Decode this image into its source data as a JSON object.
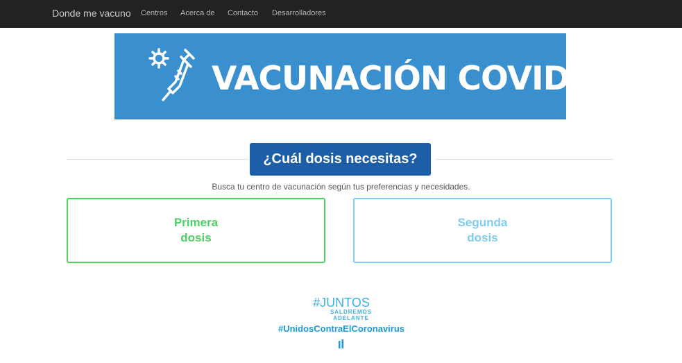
{
  "navbar": {
    "brand": "Donde me vacuno",
    "links": [
      "Centros",
      "Acerca de",
      "Contacto",
      "Desarrolladores"
    ]
  },
  "banner": {
    "title": "VACUNACIÓN COVID",
    "background": "#3a8fcf",
    "icon": "syringe-virus-icon"
  },
  "main": {
    "heading": "¿Cuál dosis necesitas?",
    "subtitle": "Busca tu centro de vacunación según tus preferencias y necesidades.",
    "first_dose": {
      "line1": "Primera",
      "line2": "dosis",
      "color": "#4cd164"
    },
    "second_dose": {
      "line1": "Segunda",
      "line2": "dosis",
      "color": "#7dcdf0"
    }
  },
  "footer_logo": {
    "line1": "#JUNTOS",
    "line2": "SALDREMOS",
    "line3": "ADELANTE",
    "hashtag": "#UnidosContraElCoronavirus"
  }
}
